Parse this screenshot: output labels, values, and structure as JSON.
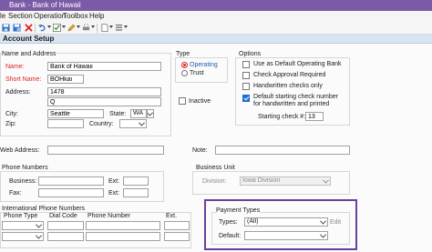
{
  "window": {
    "title": "Bank - Bank of Hawaii"
  },
  "menu": [
    "le",
    "Section",
    "Operation",
    "Toolbox",
    "Help"
  ],
  "toolbar": {
    "icons": [
      "save-icon",
      "save-all-icon",
      "close-icon",
      "undo-icon",
      "checkmark-icon",
      "edit-icon",
      "print-icon",
      "page-icon",
      "list-icon"
    ]
  },
  "section_title": "Account Setup",
  "name_address": {
    "heading": "Name and Address",
    "name_label": "Name:",
    "name_value": "Bank of Hawaii",
    "short_name_label": "Short Name:",
    "short_name_value": "BOHkai",
    "address_label": "Address:",
    "address1_value": "1478",
    "address2_value": "Q",
    "city_label": "City:",
    "city_value": "Seattle",
    "state_label": "State:",
    "state_value": "WA",
    "zip_label": "Zip:",
    "zip_value": "",
    "country_label": "Country:",
    "country_value": ""
  },
  "type": {
    "heading": "Type",
    "options": [
      "Operating",
      "Trust"
    ],
    "selected": "Operating",
    "inactive_label": "Inactive"
  },
  "options": {
    "heading": "Options",
    "items": [
      {
        "label": "Use as Default Operating Bank",
        "checked": false
      },
      {
        "label": "Check Approval Required",
        "checked": false
      },
      {
        "label": "Handwritten checks only",
        "checked": false
      },
      {
        "label": "Default starting check number",
        "label2": "for handwritten and printed",
        "checked": true
      }
    ],
    "starting_check_label": "Starting check #:",
    "starting_check_value": "13"
  },
  "web_address_label": "Web Address:",
  "web_address_value": "",
  "note_label": "Note:",
  "note_value": "",
  "phone_numbers": {
    "heading": "Phone Numbers",
    "business_label": "Business:",
    "fax_label": "Fax:",
    "ext_label": "Ext:"
  },
  "business_unit": {
    "heading": "Business Unit",
    "division_label": "Division:",
    "division_value": "Iowa Division"
  },
  "intl_phone": {
    "heading": "International Phone Numbers",
    "columns": [
      "Phone Type",
      "Dial Code",
      "Phone Number",
      "Ext."
    ]
  },
  "payment_types": {
    "heading": "Payment Types",
    "types_label": "Types:",
    "types_value": "(All)",
    "edit_label": "Edit",
    "default_label": "Default:",
    "default_value": ""
  },
  "colors": {
    "title_bar": "#7b5aa6",
    "section_header": "#d8e4f1",
    "highlight": "#6b3fa0",
    "required_label": "#d22222",
    "accent": "#1f6fd1"
  }
}
